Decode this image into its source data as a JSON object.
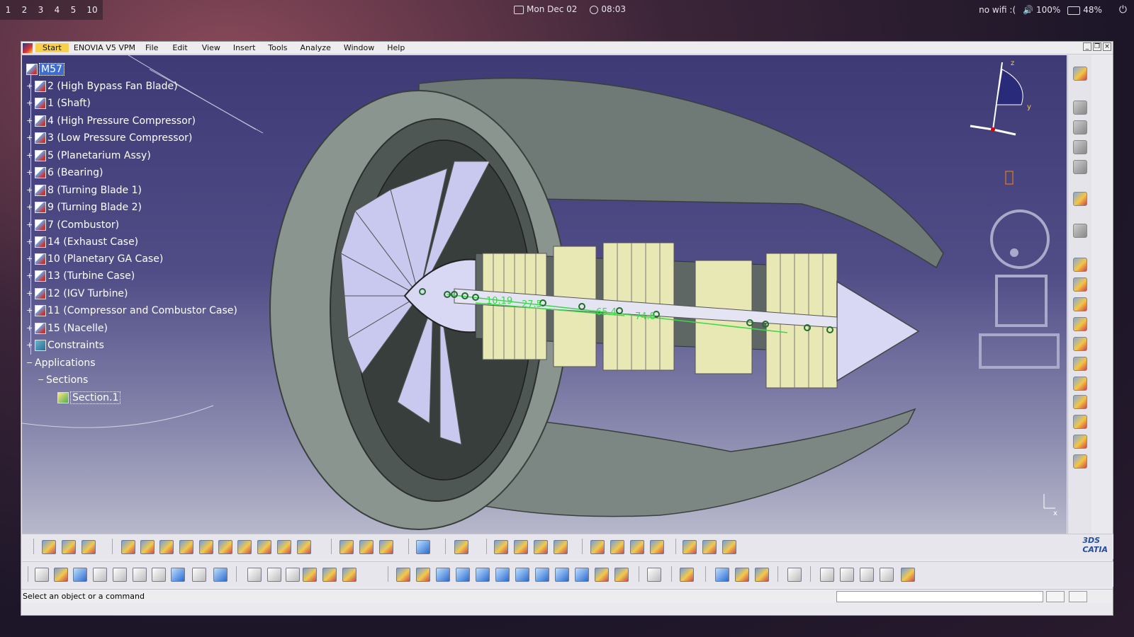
{
  "desktop": {
    "workspaces": [
      "1",
      "2",
      "3",
      "4",
      "5",
      "10"
    ],
    "date": "Mon Dec 02",
    "time": "08:03",
    "network": "no wifi :(",
    "volume": "100%",
    "battery": "48%"
  },
  "window": {
    "menu": [
      "Start",
      "ENOVIA V5 VPM",
      "File",
      "Edit",
      "View",
      "Insert",
      "Tools",
      "Analyze",
      "Window",
      "Help"
    ]
  },
  "tree": {
    "root": "M57",
    "parts": [
      "2 (High Bypass Fan Blade)",
      "1 (Shaft)",
      "4 (High Pressure Compressor)",
      "3 (Low Pressure Compressor)",
      "5 (Planetarium Assy)",
      "6 (Bearing)",
      "8 (Turning Blade 1)",
      "9 (Turning Blade 2)",
      "7 (Combustor)",
      "14 (Exhaust Case)",
      "10 (Planetary GA Case)",
      "13 (Turbine Case)",
      "12 (IGV Turbine)",
      "11 (Compressor and Combustor Case)",
      "15 (Nacelle)"
    ],
    "constraints": "Constraints",
    "applications": "Applications",
    "sections": "Sections",
    "section_item": "Section.1"
  },
  "model": {
    "dimensions": [
      "74.8",
      "65.4",
      "27.5",
      "10.19"
    ]
  },
  "compass": {
    "z": "z",
    "y": "y",
    "x": "x"
  },
  "logo": {
    "text": "CATIA",
    "mark": "3DS"
  },
  "status": {
    "message": "Select an object or a command"
  },
  "colors": {
    "viewport_top": "#3e3a76",
    "viewport_bottom": "#b8b8cc",
    "nacelle": "#7f8a85",
    "blades": "#c9c8ee",
    "compressor": "#e8e8b4",
    "section_line": "#3ed64a",
    "selection": "#3f6ccf"
  }
}
